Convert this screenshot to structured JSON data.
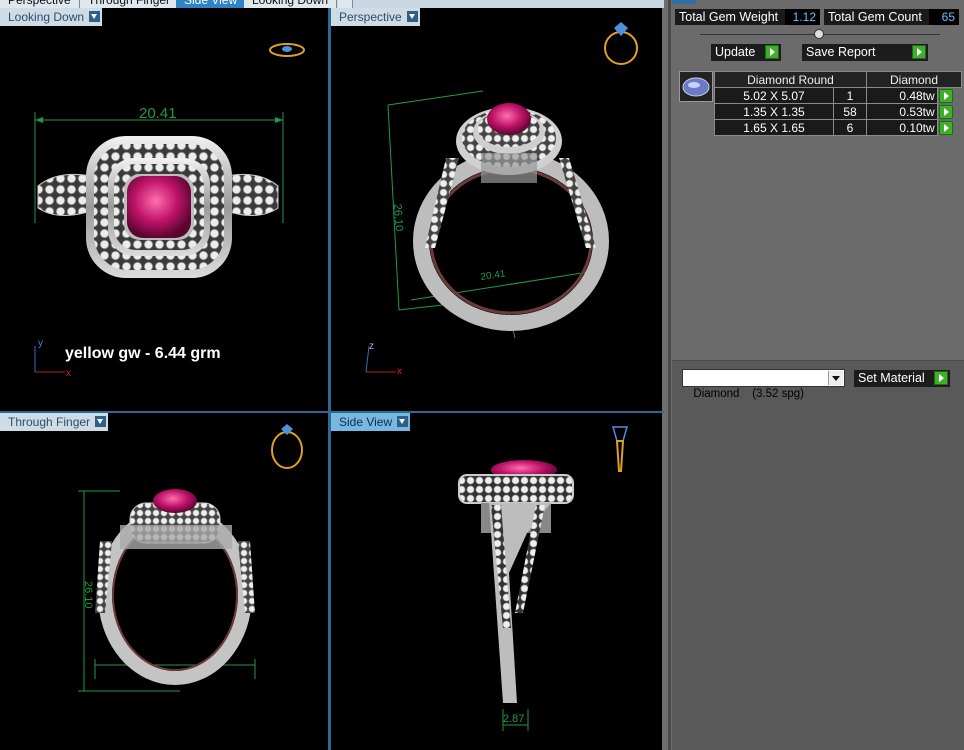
{
  "tabs": [
    {
      "label": "Perspective",
      "active": false
    },
    {
      "label": "Through Finger",
      "active": false
    },
    {
      "label": "Side View",
      "active": true
    },
    {
      "label": "Looking Down",
      "active": false
    }
  ],
  "viewports": {
    "looking_down": {
      "label": "Looking Down",
      "dimension": "20.41",
      "note": "yellow gw - 6.44 grm",
      "axes": {
        "vertical": "y",
        "horizontal": "x"
      }
    },
    "perspective": {
      "label": "Perspective",
      "dimension_height": "26.10",
      "dimension_width": "20.41",
      "axes": {
        "vertical": "z",
        "horizontal": "x"
      }
    },
    "through_finger": {
      "label": "Through Finger",
      "dimension_height": "26.10"
    },
    "side_view": {
      "label": "Side View",
      "dimension": "2.87"
    }
  },
  "panel": {
    "total_gem_weight_label": "Total Gem Weight",
    "total_gem_weight_value": "1.12",
    "total_gem_count_label": "Total Gem Count",
    "total_gem_count_value": "65",
    "update_label": "Update",
    "save_report_label": "Save Report",
    "gem_table": {
      "headers": [
        "Diamond Round",
        "Diamond"
      ],
      "rows": [
        {
          "size": "5.02 X 5.07",
          "count": "1",
          "weight": "0.48tw"
        },
        {
          "size": "1.35 X 1.35",
          "count": "58",
          "weight": "0.53tw"
        },
        {
          "size": "1.65 X 1.65",
          "count": "6",
          "weight": "0.10tw"
        }
      ]
    },
    "material_select": "Diamond    (3.52 spg)",
    "set_material_label": "Set Material"
  },
  "colors": {
    "viewport_bg": "#000000",
    "panel_bg": "#6b6b6b",
    "active_tab": "#2f83c6",
    "dimension": "#1f9a4a",
    "value_text": "#5fc6ff",
    "gem": "#d6207a",
    "metal": "#c8c8c8"
  }
}
